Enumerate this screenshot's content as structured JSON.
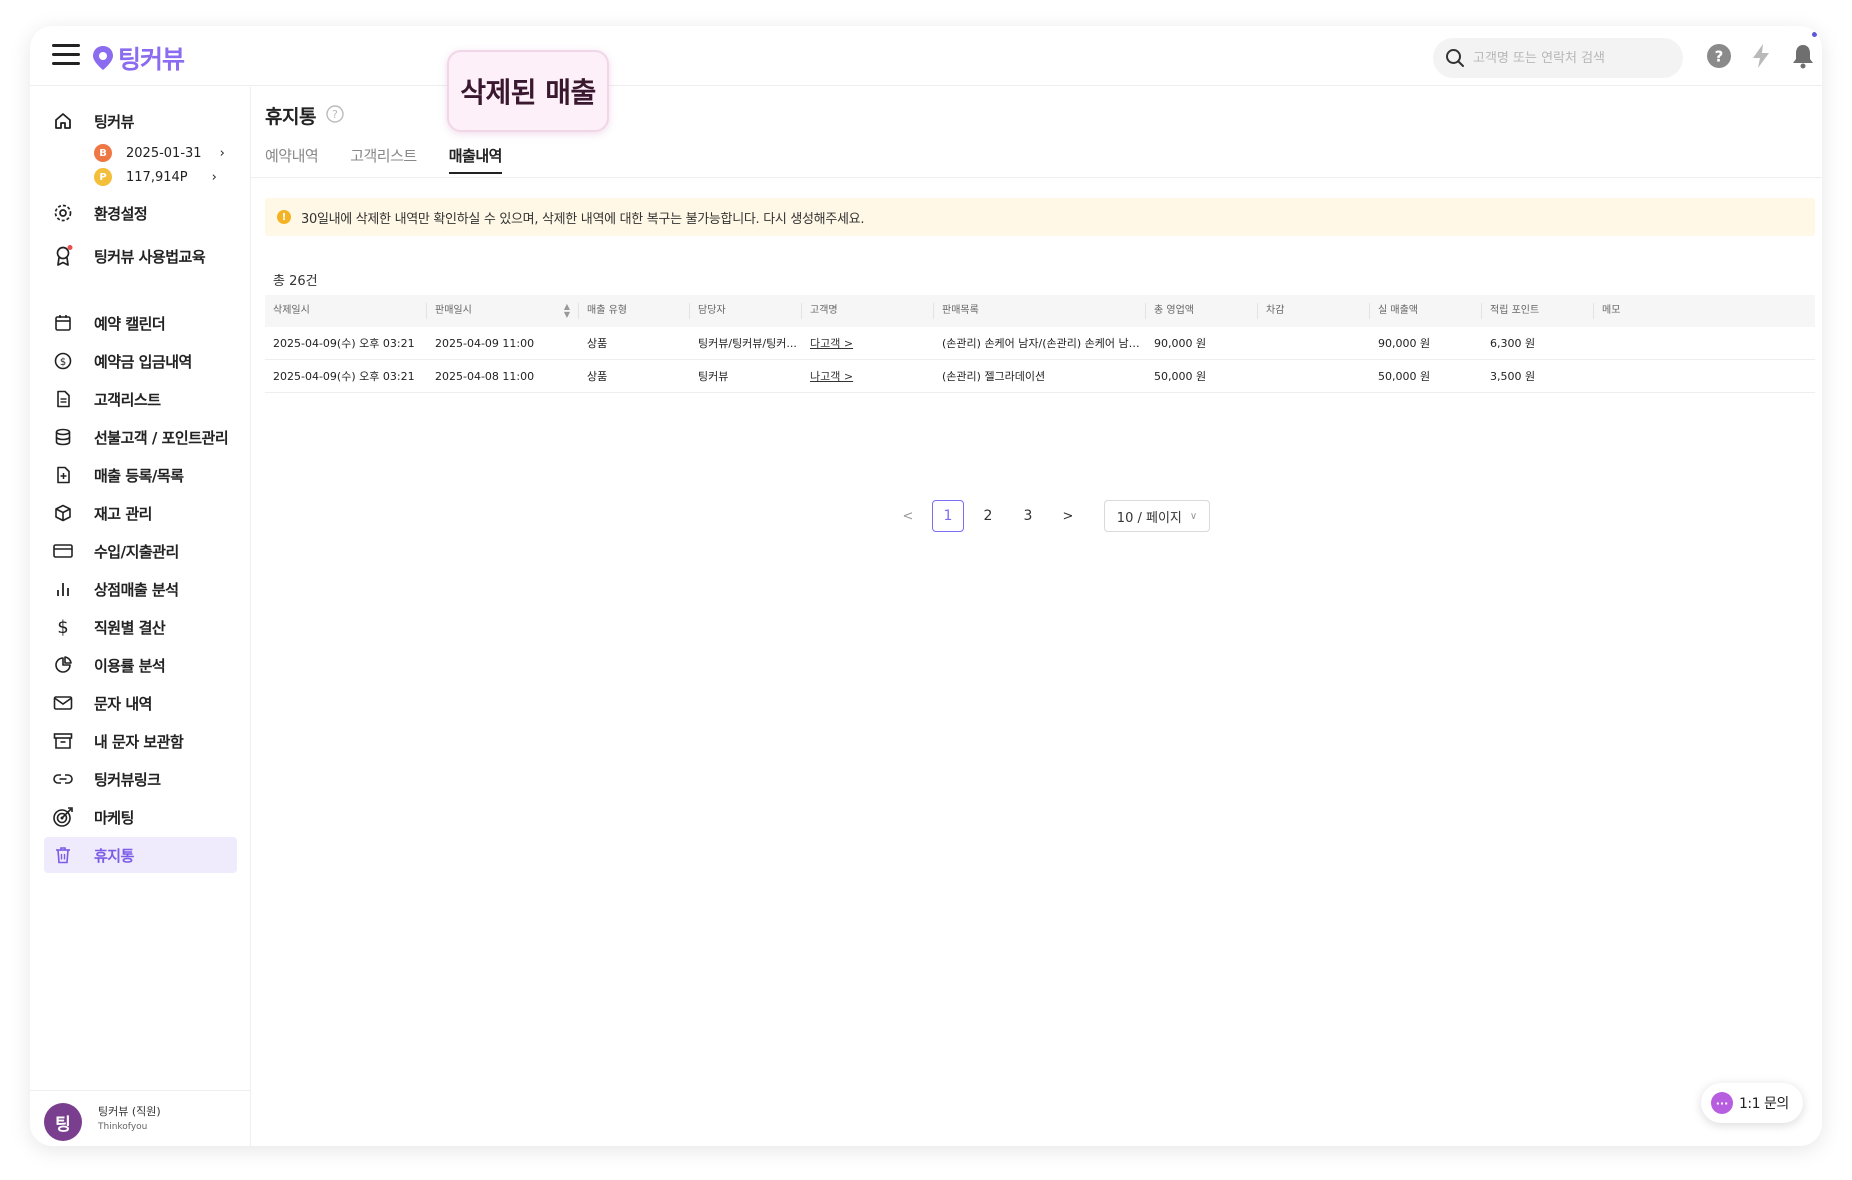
{
  "header": {
    "logo_text": "팅커뷰",
    "search_placeholder": "고객명 또는 연락처 검색"
  },
  "sidebar": {
    "home_label": "팅커뷰",
    "plan_date": "2025-01-31",
    "plan_badge": "B",
    "points": "117,914P",
    "points_badge": "P",
    "settings_label": "환경설정",
    "education_label": "팅커뷰 사용법교육",
    "items": [
      {
        "label": "예약 캘린더",
        "icon": "calendar-icon"
      },
      {
        "label": "예약금 입금내역",
        "icon": "coin-icon"
      },
      {
        "label": "고객리스트",
        "icon": "document-icon"
      },
      {
        "label": "선불고객 / 포인트관리",
        "icon": "database-icon"
      },
      {
        "label": "매출 등록/목록",
        "icon": "file-plus-icon"
      },
      {
        "label": "재고 관리",
        "icon": "box-icon"
      },
      {
        "label": "수입/지출관리",
        "icon": "credit-card-icon"
      },
      {
        "label": "상점매출 분석",
        "icon": "bar-chart-icon"
      },
      {
        "label": "직원별 결산",
        "icon": "dollar-icon"
      },
      {
        "label": "이용률 분석",
        "icon": "pie-chart-icon"
      },
      {
        "label": "문자 내역",
        "icon": "mail-icon"
      },
      {
        "label": "내 문자 보관함",
        "icon": "archive-icon"
      },
      {
        "label": "팅커뷰링크",
        "icon": "link-icon"
      },
      {
        "label": "마케팅",
        "icon": "target-icon"
      },
      {
        "label": "휴지통",
        "icon": "trash-icon"
      }
    ],
    "profile": {
      "avatar": "팅",
      "name": "팅커뷰 (직원)",
      "sub": "Thinkofyou"
    }
  },
  "main": {
    "title": "휴지통",
    "tooltip": "삭제된 매출",
    "tabs": [
      {
        "label": "예약내역"
      },
      {
        "label": "고객리스트"
      },
      {
        "label": "매출내역"
      }
    ],
    "active_tab": 2,
    "notice": "30일내에 삭제한 내역만 확인하실 수 있으며, 삭제한 내역에 대한 복구는 불가능합니다. 다시 생성해주세요.",
    "total": "총 26건",
    "columns": [
      "삭제일시",
      "판매일시",
      "매출 유형",
      "담당자",
      "고객명",
      "판매목록",
      "총 영업액",
      "차감",
      "실 매출액",
      "적립 포인트",
      "메모"
    ],
    "rows": [
      {
        "deleted_at": "2025-04-09(수) 오후 03:21",
        "sold_at": "2025-04-09 11:00",
        "type": "상품",
        "staff": "팅커뷰/팅커뷰/팅커...",
        "customer": "다고객 >",
        "items": "(손관리) 손케어 남자/(손관리) 손케어 남자/...",
        "total_sales": "90,000 원",
        "deduction": "",
        "net_sales": "90,000 원",
        "points": "6,300 원",
        "memo": ""
      },
      {
        "deleted_at": "2025-04-09(수) 오후 03:21",
        "sold_at": "2025-04-08 11:00",
        "type": "상품",
        "staff": "팅커뷰",
        "customer": "나고객 >",
        "items": "(손관리) 젤그라데이션",
        "total_sales": "50,000 원",
        "deduction": "",
        "net_sales": "50,000 원",
        "points": "3,500 원",
        "memo": ""
      }
    ],
    "pagination": {
      "prev": "<",
      "next": ">",
      "pages": [
        "1",
        "2",
        "3"
      ],
      "current": "1",
      "page_size": "10 / 페이지"
    }
  },
  "chat": {
    "label": "1:1 문의"
  },
  "colors": {
    "brand": "#8b6cf0",
    "active_bg": "#efebfd",
    "notice_bg": "#fff8e6",
    "tooltip_bg": "#fdf0f8"
  }
}
